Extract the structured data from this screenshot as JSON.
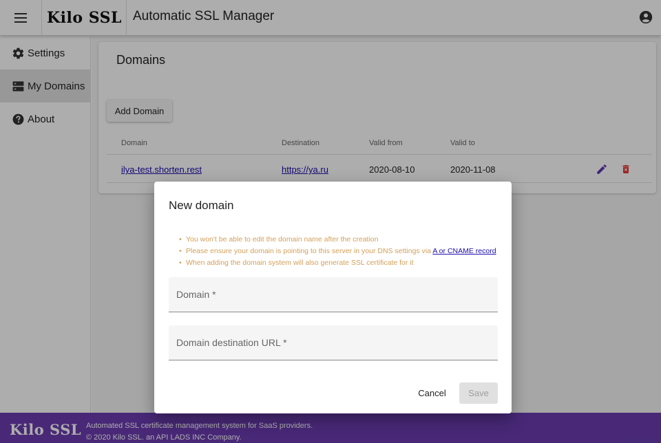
{
  "header": {
    "logo": "Kilo SSL",
    "title": "Automatic SSL Manager",
    "menu_icon": "menu-icon",
    "account_icon": "account-circle-icon"
  },
  "sidebar": {
    "items": [
      {
        "label": "Settings",
        "icon": "gear-icon",
        "active": false
      },
      {
        "label": "My Domains",
        "icon": "dns-icon",
        "active": true
      },
      {
        "label": "About",
        "icon": "help-icon",
        "active": false
      }
    ]
  },
  "domains": {
    "title": "Domains",
    "add_button": "Add Domain",
    "columns": [
      "Domain",
      "Destination",
      "Valid from",
      "Valid to"
    ],
    "rows": [
      {
        "domain": "ilya-test.shorten.rest",
        "destination": "https://ya.ru",
        "valid_from": "2020-08-10",
        "valid_to": "2020-11-08"
      }
    ]
  },
  "dialog": {
    "title": "New domain",
    "notes": {
      "n1": "You won't be able to edit the domain name after the creation",
      "n2_text": "Please ensure your domain is pointing to this server in your DNS settings via ",
      "n2_link": "A or CNAME record",
      "n3": "When adding the domain system will also generate SSL certificate for it"
    },
    "domain_placeholder": "Domain *",
    "destination_placeholder": "Domain destination URL *",
    "cancel_label": "Cancel",
    "save_label": "Save"
  },
  "footer": {
    "logo": "Kilo SSL",
    "line1": "Automated SSL certificate management system for SaaS providers.",
    "line2": "© 2020 Kilo SSL. an API LADS INC Company."
  },
  "colors": {
    "accent": "#6a3cb0",
    "edit_icon": "#5e35b1",
    "delete_icon": "#e53935",
    "notice_text": "#d3a05a"
  }
}
